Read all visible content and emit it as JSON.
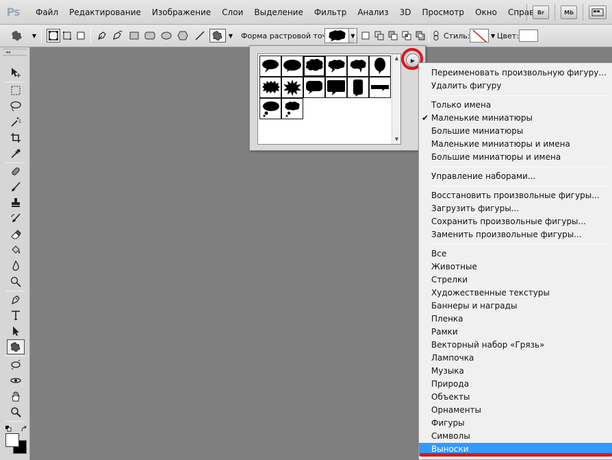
{
  "app": {
    "logo": "Ps",
    "menu": [
      "Файл",
      "Редактирование",
      "Изображение",
      "Слои",
      "Выделение",
      "Фильтр",
      "Анализ",
      "3D",
      "Просмотр",
      "Окно",
      "Справка"
    ],
    "right_buttons": [
      "Br",
      "Mb"
    ]
  },
  "options_bar": {
    "shape_label": "Форма растровой точки:",
    "style_label": "Стиль:",
    "color_label": "Цвет:"
  },
  "shape_panel": {
    "shapes": [
      "speech-oval",
      "speech-round",
      "thought-cloud",
      "speech-cloud",
      "speech-cloud-2",
      "speech-tall",
      "burst-wavy",
      "burst-star",
      "speech-rect-rounded",
      "speech-rect",
      "speech-tall-rect",
      "banner-bar",
      "thought-oval",
      "thought-cloud-small"
    ],
    "selected_index": 2
  },
  "context_menu": {
    "items": [
      {
        "label": "Переименовать произвольную фигуру..."
      },
      {
        "label": "Удалить фигуру"
      },
      {
        "separator": true
      },
      {
        "label": "Только имена"
      },
      {
        "label": "Маленькие миниатюры",
        "checked": true
      },
      {
        "label": "Большие миниатюры"
      },
      {
        "label": "Маленькие миниатюры и имена"
      },
      {
        "label": "Большие миниатюры и имена"
      },
      {
        "separator": true
      },
      {
        "label": "Управление наборами..."
      },
      {
        "separator": true
      },
      {
        "label": "Восстановить произвольные фигуры..."
      },
      {
        "label": "Загрузить фигуры..."
      },
      {
        "label": "Сохранить произвольные фигуры..."
      },
      {
        "label": "Заменить произвольные фигуры..."
      },
      {
        "separator": true
      },
      {
        "label": "Все"
      },
      {
        "label": "Животные"
      },
      {
        "label": "Стрелки"
      },
      {
        "label": "Художественные текстуры"
      },
      {
        "label": "Баннеры и награды"
      },
      {
        "label": "Пленка"
      },
      {
        "label": "Рамки"
      },
      {
        "label": "Векторный набор «Грязь»"
      },
      {
        "label": "Лампочка"
      },
      {
        "label": "Музыка"
      },
      {
        "label": "Природа"
      },
      {
        "label": "Объекты"
      },
      {
        "label": "Орнаменты"
      },
      {
        "label": "Фигуры"
      },
      {
        "label": "Символы"
      },
      {
        "label": "Выноски",
        "highlighted": true
      }
    ],
    "highlight_color": "#3399ff",
    "annotation_color": "#e0151b"
  }
}
